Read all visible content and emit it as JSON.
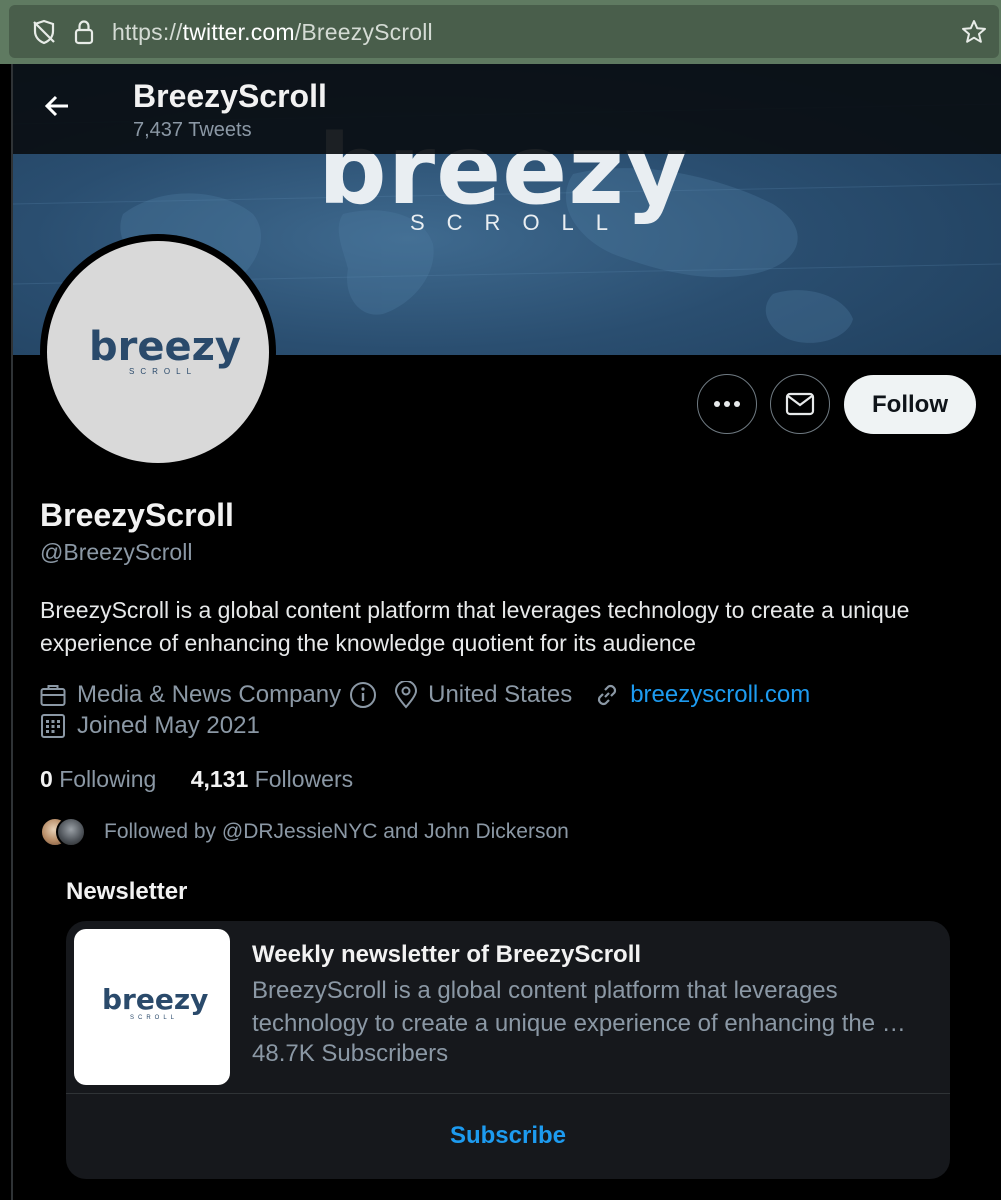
{
  "browser": {
    "url_prefix": "https://",
    "url_domain": "twitter.com",
    "url_path": "/BreezyScroll"
  },
  "header": {
    "title": "BreezyScroll",
    "tweet_count": "7,437 Tweets"
  },
  "banner": {
    "brand": "breezy",
    "sub": "SCROLL"
  },
  "avatar": {
    "brand": "breezy",
    "sub": "SCROLL"
  },
  "profile": {
    "name": "BreezyScroll",
    "handle": "@BreezyScroll",
    "bio": "BreezyScroll is a global content platform that leverages technology to create a unique experience of enhancing the knowledge quotient for its audience",
    "category": "Media & News Company",
    "location": "United States",
    "website": "breezyscroll.com",
    "joined": "Joined May 2021",
    "follow_label": "Follow"
  },
  "stats": {
    "following_count": "0",
    "following_label": "Following",
    "followers_count": "4,131",
    "followers_label": "Followers"
  },
  "followed_by": "Followed by @DRJessieNYC and John Dickerson",
  "newsletter": {
    "heading": "Newsletter",
    "title": "Weekly newsletter of BreezyScroll",
    "description": "BreezyScroll is a global content platform that leverages technology to create a unique experience of enhancing the …",
    "subscribers": "48.7K Subscribers",
    "subscribe_label": "Subscribe",
    "thumb_brand": "breezy",
    "thumb_sub": "SCROLL"
  },
  "colors": {
    "accent": "#1d9bf0",
    "background": "#000000",
    "banner": "#2a4e70",
    "browser_chrome": "#5f7a61"
  }
}
